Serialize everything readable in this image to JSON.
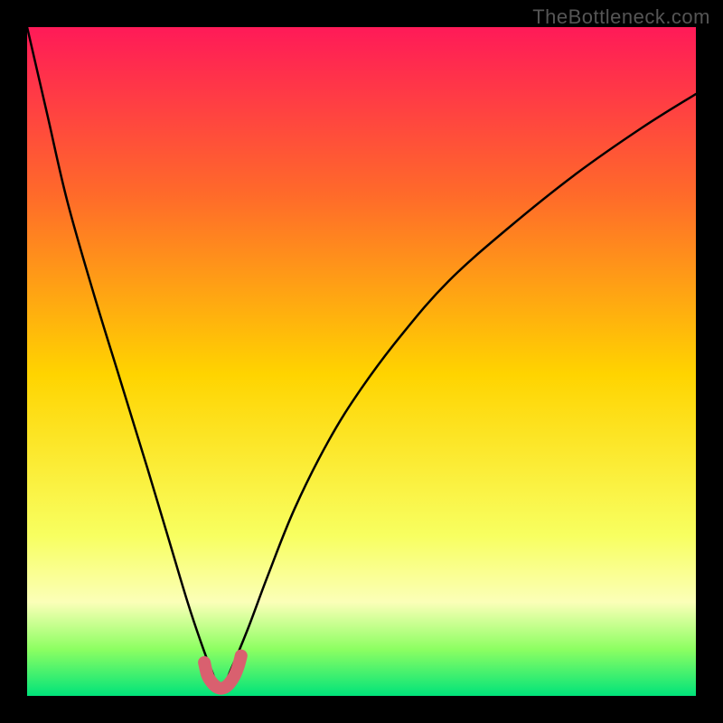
{
  "watermark": "TheBottleneck.com",
  "colors": {
    "frame": "#000000",
    "gradient_top": "#ff1a58",
    "gradient_upper_mid": "#ff6a2a",
    "gradient_mid": "#ffd400",
    "gradient_lower_mid": "#f8ff60",
    "gradient_pale_band": "#fbffb8",
    "gradient_green_top": "#8dff62",
    "gradient_green_bottom": "#00e37a",
    "curve": "#000000",
    "bottom_arc": "#d9606f"
  },
  "chart_data": {
    "type": "line",
    "title": "",
    "xlabel": "",
    "ylabel": "",
    "xlim": [
      0,
      100
    ],
    "ylim": [
      0,
      100
    ],
    "series": [
      {
        "name": "bottleneck-curve",
        "x": [
          0,
          3,
          6,
          10,
          14,
          18,
          21,
          24,
          26,
          27.5,
          29,
          30.5,
          33,
          36,
          40,
          45,
          50,
          56,
          63,
          72,
          82,
          92,
          100
        ],
        "y": [
          100,
          87,
          74,
          60,
          47,
          34,
          24,
          14,
          8,
          4,
          1,
          4,
          10,
          18,
          28,
          38,
          46,
          54,
          62,
          70,
          78,
          85,
          90
        ]
      },
      {
        "name": "bottom-arc",
        "x": [
          26.5,
          27,
          27.8,
          28.6,
          29.4,
          30.2,
          31,
          31.6,
          32
        ],
        "y": [
          5,
          3,
          1.8,
          1.2,
          1.2,
          1.8,
          3,
          4.5,
          6
        ]
      }
    ]
  }
}
